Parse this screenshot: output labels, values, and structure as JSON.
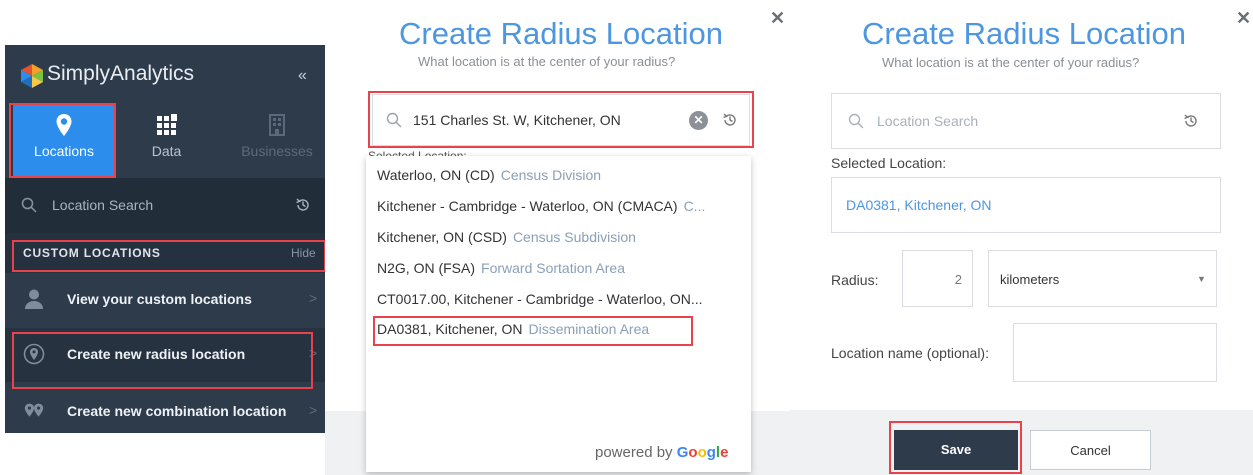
{
  "sidebar": {
    "brand": "SimplyAnalytics",
    "collapse_label": "«",
    "tabs": [
      {
        "label": "Locations"
      },
      {
        "label": "Data"
      },
      {
        "label": "Businesses"
      }
    ],
    "search_placeholder": "Location Search",
    "custom_header": "CUSTOM LOCATIONS",
    "hide_label": "Hide",
    "items": [
      {
        "label": "View your custom locations"
      },
      {
        "label": "Create new radius location"
      },
      {
        "label": "Create new combination location"
      }
    ],
    "chevron": ">"
  },
  "panel2": {
    "title": "Create Radius Location",
    "subtitle": "What location is at the center of your radius?",
    "close": "✕",
    "search_value": "151 Charles St. W, Kitchener, ON",
    "clear": "✕",
    "peek_text": "Selected Location:",
    "suggestions": [
      {
        "name": "Waterloo, ON (CD)",
        "type": "Census Division"
      },
      {
        "name": "Kitchener - Cambridge - Waterloo, ON (CMACA)",
        "type": "C..."
      },
      {
        "name": "Kitchener, ON (CSD)",
        "type": "Census Subdivision"
      },
      {
        "name": "N2G, ON (FSA)",
        "type": "Forward Sortation Area"
      },
      {
        "name": "CT0017.00, Kitchener - Cambridge - Waterloo, ON...",
        "type": ""
      },
      {
        "name": "DA0381, Kitchener, ON",
        "type": "Dissemination Area"
      }
    ],
    "powered_by": "powered by",
    "google": "Google"
  },
  "panel3": {
    "title": "Create Radius Location",
    "subtitle": "What location is at the center of your radius?",
    "close": "✕",
    "search_placeholder": "Location Search",
    "selected_label": "Selected Location:",
    "selected_value": "DA0381, Kitchener, ON",
    "radius_label": "Radius:",
    "radius_value": "2",
    "unit": "kilometers",
    "unit_arrow": "▼",
    "name_label": "Location name (optional):",
    "name_value": "",
    "save": "Save",
    "cancel": "Cancel"
  },
  "colors": {
    "accent": "#2d8ded",
    "title_blue": "#4d96e0",
    "sidebar_bg": "#2e3b4b",
    "highlight": "#e8434a"
  },
  "icons": [
    "simplyanalytics-logo-icon",
    "map-pin-icon",
    "grid-icon",
    "building-icon",
    "search-icon",
    "history-icon",
    "person-icon",
    "radius-pin-icon",
    "combination-pin-icon",
    "close-icon"
  ]
}
